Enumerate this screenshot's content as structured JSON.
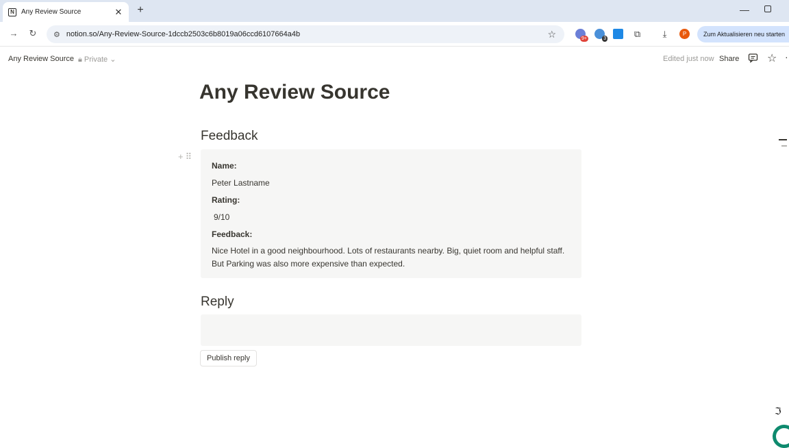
{
  "browser": {
    "tab_title": "Any Review Source",
    "url": "notion.so/Any-Review-Source-1dccb2503c6b8019a06ccd6107664a4b",
    "update_button": "Zum Aktualisieren neu starten",
    "extension_badge_1": "9+",
    "extension_badge_2": "3",
    "profile_initial": "P"
  },
  "notion_topbar": {
    "breadcrumb": "Any Review Source",
    "privacy": "Private",
    "edited": "Edited just now",
    "share": "Share"
  },
  "page": {
    "title": "Any Review Source",
    "feedback_heading": "Feedback",
    "reply_heading": "Reply",
    "publish_button": "Publish reply"
  },
  "feedback": {
    "name_label": "Name:",
    "name_value": "Peter Lastname",
    "rating_label": "Rating:",
    "rating_value": "9/10",
    "feedback_label": "Feedback:",
    "feedback_text": "Nice Hotel in a good neighbourhood. Lots of restaurants nearby. Big, quiet room and helpful staff. But Parking was also more expensive than expected."
  },
  "colors": {
    "accent_blue": "#d3e3fd",
    "text": "#37352f",
    "muted": "#9b9a97",
    "callout_bg": "#f6f6f5"
  }
}
